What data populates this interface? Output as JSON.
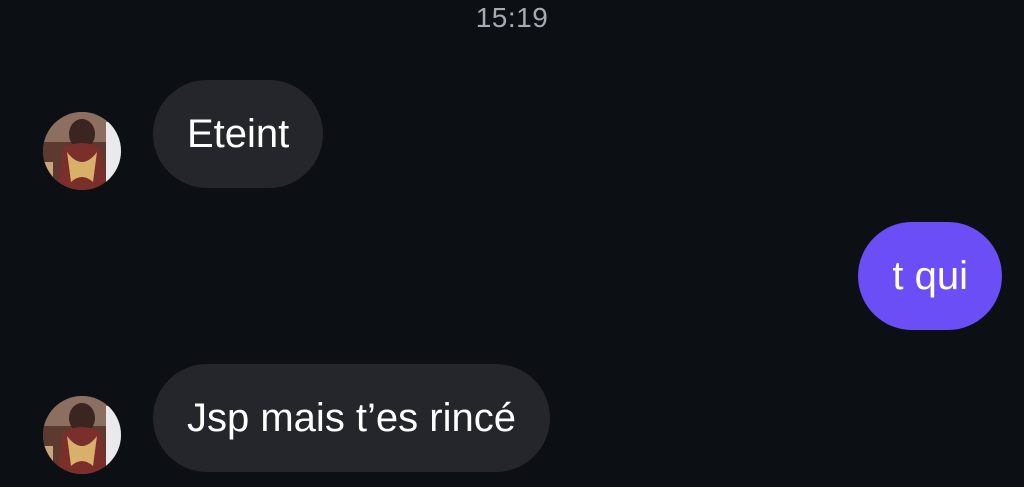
{
  "chat": {
    "timestamp": "15:19",
    "messages": [
      {
        "direction": "incoming",
        "text": "Eteint",
        "avatar": "contact-avatar"
      },
      {
        "direction": "outgoing",
        "text": "t qui"
      },
      {
        "direction": "incoming",
        "text": "Jsp mais t’es rincé",
        "avatar": "contact-avatar"
      }
    ]
  },
  "colors": {
    "background": "#0c0f13",
    "incoming_bubble": "#24262c",
    "outgoing_bubble": "#6b4ef6",
    "timestamp_text": "#a6abb3"
  }
}
